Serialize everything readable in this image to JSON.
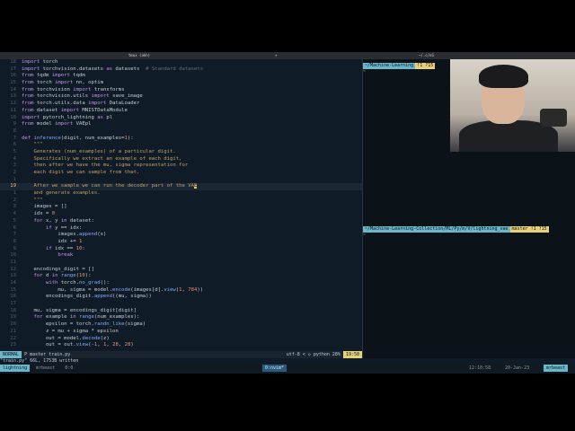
{
  "titlebar": {
    "left": "tmux (akh)",
    "mid": "~/.c/nG",
    "right": "+"
  },
  "editor": {
    "lines": [
      {
        "n": "18",
        "html": "<span class=\"kw\">import</span> torch"
      },
      {
        "n": "17",
        "html": "<span class=\"kw\">import</span> torchvision.datasets <span class=\"kw\">as</span> datasets  <span class=\"cm\"># Standard datasets</span>"
      },
      {
        "n": "16",
        "html": "<span class=\"kw\">from</span> tqdm <span class=\"kw\">import</span> tqdm"
      },
      {
        "n": "15",
        "html": "<span class=\"kw\">from</span> torch <span class=\"kw\">import</span> nn, optim"
      },
      {
        "n": "14",
        "html": "<span class=\"kw\">from</span> torchvision <span class=\"kw\">import</span> transforms"
      },
      {
        "n": "13",
        "html": "<span class=\"kw\">from</span> torchvision.utils <span class=\"kw\">import</span> save_image"
      },
      {
        "n": "12",
        "html": "<span class=\"kw\">from</span> torch.utils.data <span class=\"kw\">import</span> DataLoader"
      },
      {
        "n": "11",
        "html": "<span class=\"kw\">from</span> dataset <span class=\"kw\">import</span> MNISTDataModule"
      },
      {
        "n": "10",
        "html": "<span class=\"kw\">import</span> pytorch_lightning <span class=\"kw\">as</span> pl"
      },
      {
        "n": "9",
        "html": "<span class=\"kw\">from</span> model <span class=\"kw\">import</span> VAEpl"
      },
      {
        "n": "8",
        "html": ""
      },
      {
        "n": "7",
        "html": "<span class=\"kw\">def</span> <span class=\"fn\">inference</span>(digit, num_examples=<span class=\"num\">1</span>):"
      },
      {
        "n": "6",
        "html": "    <span class=\"str\">\"\"\"</span>"
      },
      {
        "n": "5",
        "html": "<span class=\"str\">    Generates (num_examples) of a particular digit.</span>"
      },
      {
        "n": "4",
        "html": "<span class=\"str\">    Specifically we extract an example of each digit,</span>"
      },
      {
        "n": "3",
        "html": "<span class=\"str\">    then after we have the mu, sigma representation for</span>"
      },
      {
        "n": "2",
        "html": "<span class=\"str\">    each digit we can sample from that.</span>"
      },
      {
        "n": "1",
        "html": ""
      },
      {
        "n": "19",
        "cur": true,
        "html": "<span class=\"str\">    After we sample we can run the decoder part of the VA</span><span class=\"cursor\">E</span>"
      },
      {
        "n": "1",
        "html": "<span class=\"str\">    and generate examples.</span>"
      },
      {
        "n": "2",
        "html": "    <span class=\"str\">\"\"\"</span>"
      },
      {
        "n": "3",
        "html": "    images = []"
      },
      {
        "n": "4",
        "html": "    idx = <span class=\"num\">0</span>"
      },
      {
        "n": "5",
        "html": "    <span class=\"kw\">for</span> x, y <span class=\"kw\">in</span> dataset:"
      },
      {
        "n": "6",
        "html": "        <span class=\"kw\">if</span> y == idx:"
      },
      {
        "n": "7",
        "html": "            images.<span class=\"fn\">append</span>(x)"
      },
      {
        "n": "8",
        "html": "            idx += <span class=\"num\">1</span>"
      },
      {
        "n": "9",
        "html": "        <span class=\"kw\">if</span> idx == <span class=\"num\">10</span>:"
      },
      {
        "n": "10",
        "html": "            <span class=\"kw\">break</span>"
      },
      {
        "n": "11",
        "html": ""
      },
      {
        "n": "12",
        "html": "    encodings_digit = []"
      },
      {
        "n": "13",
        "html": "    <span class=\"kw\">for</span> d <span class=\"kw\">in</span> <span class=\"fn\">range</span>(<span class=\"num\">10</span>):"
      },
      {
        "n": "14",
        "html": "        <span class=\"kw\">with</span> torch.<span class=\"fn\">no_grad</span>():"
      },
      {
        "n": "15",
        "html": "            mu, sigma = model.<span class=\"fn\">encode</span>(images[d].<span class=\"fn\">view</span>(<span class=\"num\">1</span>, <span class=\"num\">784</span>))"
      },
      {
        "n": "16",
        "html": "        encodings_digit.<span class=\"fn\">append</span>((mu, sigma))"
      },
      {
        "n": "17",
        "html": ""
      },
      {
        "n": "18",
        "html": "    mu, sigma = encodings_digit[digit]"
      },
      {
        "n": "19",
        "html": "    <span class=\"kw\">for</span> example <span class=\"kw\">in</span> <span class=\"fn\">range</span>(num_examples):"
      },
      {
        "n": "20",
        "html": "        epsilon = torch.<span class=\"fn\">randn_like</span>(sigma)"
      },
      {
        "n": "21",
        "html": "        z = mu + sigma * epsilon"
      },
      {
        "n": "22",
        "html": "        out = model.<span class=\"fn\">decode</span>(z)"
      },
      {
        "n": "23",
        "html": "        out = out.<span class=\"fn\">view</span>(-<span class=\"num\">1</span>, <span class=\"num\">1</span>, <span class=\"num\">28</span>, <span class=\"num\">28</span>)"
      }
    ]
  },
  "terminal": {
    "prompt1_path": "~/Machine-Learning",
    "prompt1_git": "!1 ?15",
    "prompt1_tail": "~",
    "prompt2_path": "~/Machine-Learning-Collection/ML/Py/m/V/lightning_vae",
    "prompt2_git": "master !1 ?15",
    "prompt2_tail": "~"
  },
  "statusline": {
    "mode": "NORMAL",
    "branch": "P master",
    "file": "train.py",
    "encoding": "utf-8",
    "filetype": "python",
    "percent": "28%",
    "position": "19:58"
  },
  "cmdline": "\"train.py\" 66L, 1753B written",
  "tmux": {
    "session": "lightning",
    "window1": "mrbeast",
    "window2": "0:0",
    "active_window": "0:nvim*",
    "time": "12:10:58",
    "date": "20-Jan-23",
    "host": "mrbeast"
  }
}
